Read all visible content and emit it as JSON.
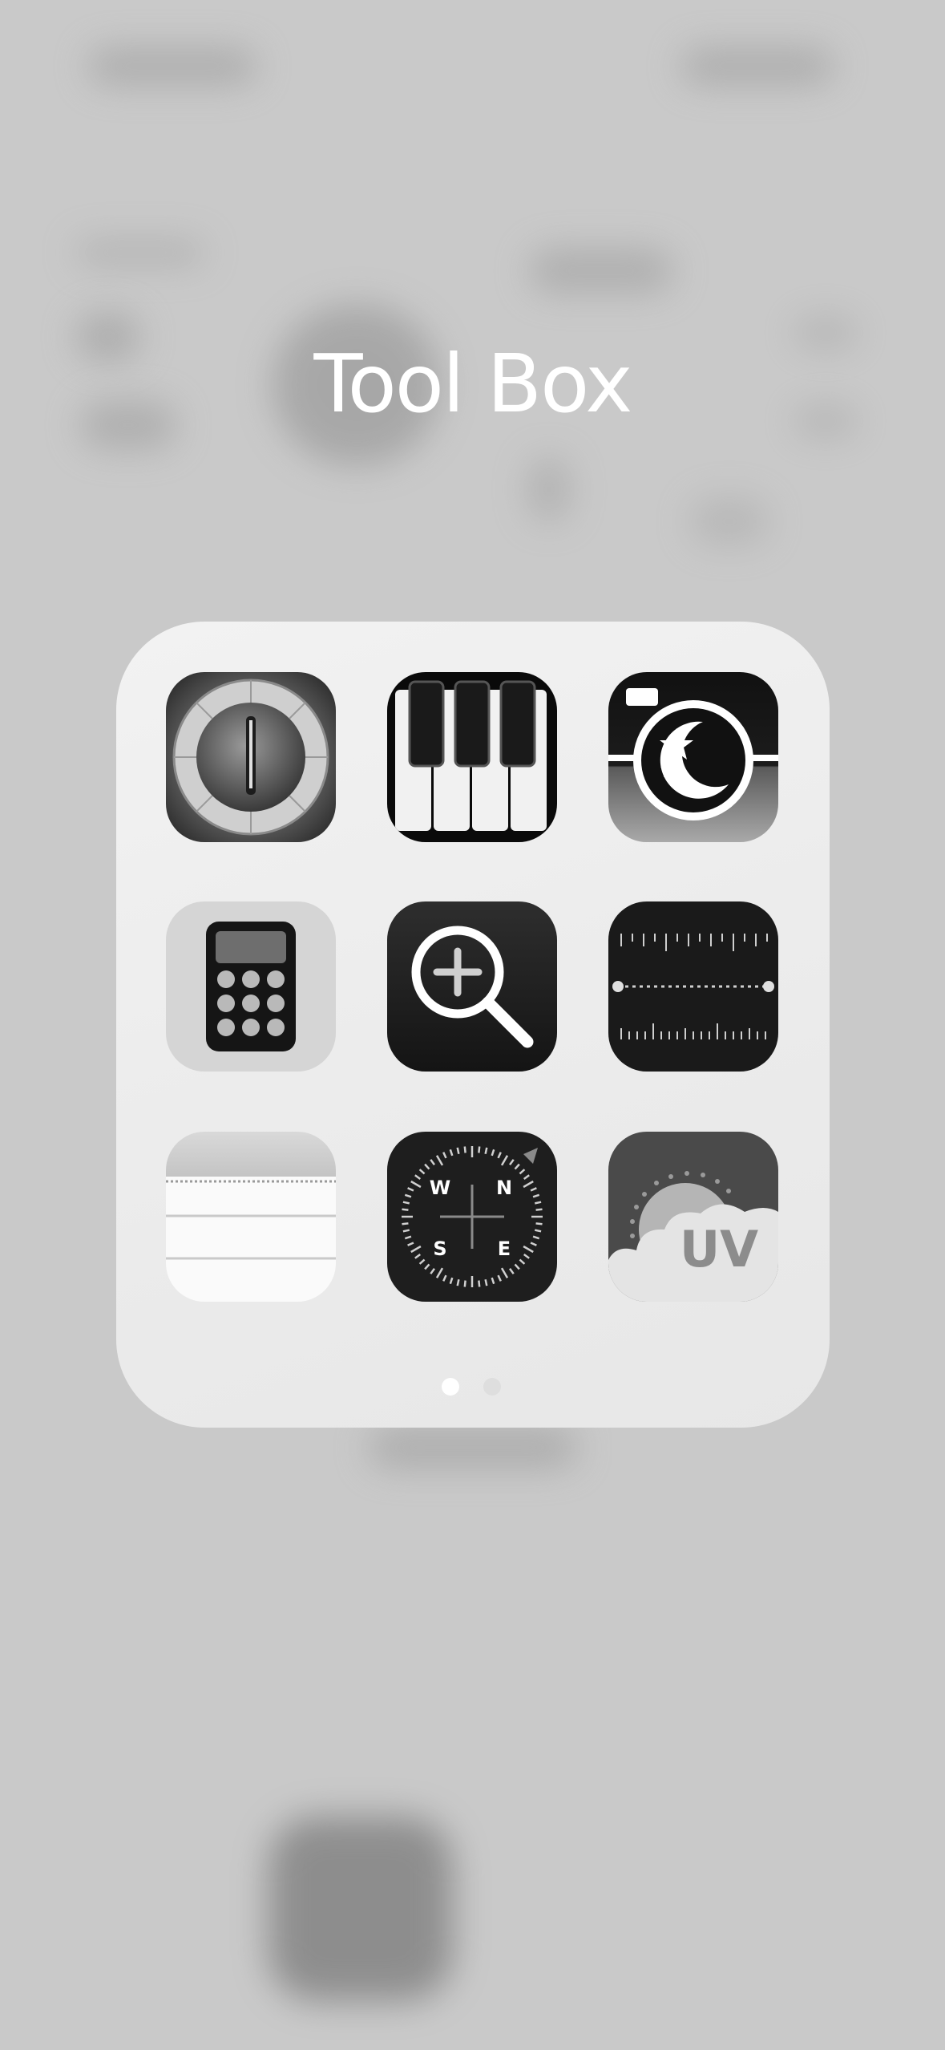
{
  "folder": {
    "title": "Tool Box",
    "apps": [
      {
        "icon": "tuner-icon"
      },
      {
        "icon": "piano-icon"
      },
      {
        "icon": "night-camera-icon"
      },
      {
        "icon": "calculator-icon"
      },
      {
        "icon": "magnifier-icon"
      },
      {
        "icon": "level-ruler-icon"
      },
      {
        "icon": "notes-icon"
      },
      {
        "icon": "compass-icon"
      },
      {
        "icon": "uv-index-icon"
      }
    ],
    "page_count": 2,
    "current_page": 1
  },
  "compass": {
    "w": "W",
    "n": "N",
    "s": "S",
    "e": "E"
  },
  "uv": {
    "label": "UV"
  }
}
